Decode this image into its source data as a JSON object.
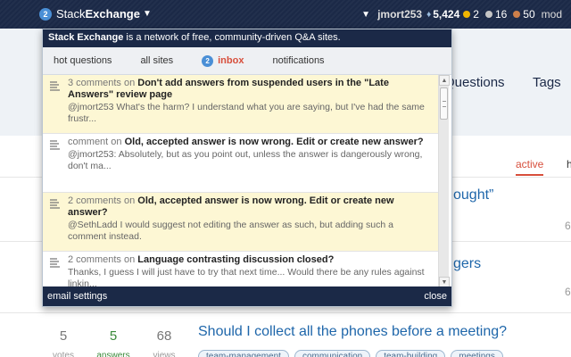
{
  "topbar": {
    "logo_badge": "2",
    "logo_text_a": "Stack",
    "logo_text_b": "Exchange",
    "logo_caret": "▼",
    "user_caret": "▼",
    "username": "jmort253",
    "diamond": "♦",
    "reputation": "5,424",
    "gold_count": "2",
    "silver_count": "16",
    "bronze_count": "50",
    "mod_label": "mod"
  },
  "dropdown": {
    "tagline_bold": "Stack Exchange",
    "tagline_rest": " is a network of free, community-driven Q&A sites.",
    "tabs": [
      {
        "label": "hot questions"
      },
      {
        "label": "all sites"
      },
      {
        "label": "inbox",
        "badge": "2"
      },
      {
        "label": "notifications"
      }
    ],
    "items": [
      {
        "count": "3 comments on",
        "title": "Don't add answers from suspended users in the \"Late Answers\" review page",
        "body": "@jmort253 What's the harm? I understand what you are saying, but I've had the same frustr..."
      },
      {
        "count": "comment on",
        "title": "Old, accepted answer is now wrong. Edit or create new answer?",
        "body": "@jmort253: Absolutely, but as you point out, unless the answer is dangerously wrong, don't ma..."
      },
      {
        "count": "2 comments on",
        "title": "Old, accepted answer is now wrong. Edit or create new answer?",
        "body": "@SethLadd I would suggest not editing the answer as such, but adding such a comment instead."
      },
      {
        "count": "2 comments on",
        "title": "Language contrasting discussion closed?",
        "body": "Thanks, I guess I will just have to try that next time... Would there be any rules against linkin..."
      }
    ],
    "footer_left": "email settings",
    "footer_right": "close"
  },
  "background": {
    "nav_questions": "Questions",
    "nav_tags": "Tags",
    "tab_active": "active",
    "tab_h": "h",
    "partial_title_1": "ought”",
    "partial_title_2": "gers",
    "num_1": "6",
    "num_2": "6",
    "num_3": "6",
    "question_title": "Should I collect all the phones before a meeting?",
    "votes": "5",
    "votes_label": "votes",
    "answers": "5",
    "answers_label": "answers",
    "views": "68",
    "views_label": "views",
    "tags": [
      "team-management",
      "communication",
      "team-building",
      "meetings"
    ]
  },
  "colors": {
    "topbar": "#1b2947",
    "accent_red": "#d74f3c",
    "link_blue": "#1e66aa",
    "unread_bg": "#fdf7d4"
  }
}
